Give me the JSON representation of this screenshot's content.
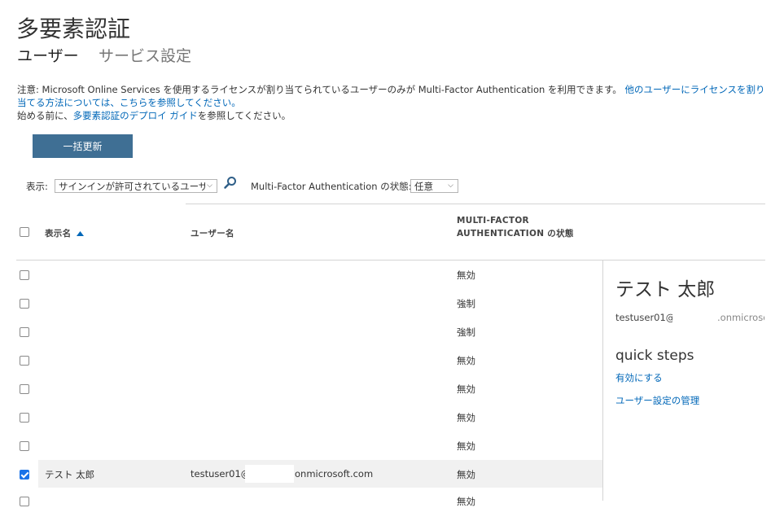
{
  "page": {
    "title": "多要素認証",
    "tabs": [
      {
        "label": "ユーザー",
        "active": true
      },
      {
        "label": "サービス設定",
        "active": false
      }
    ]
  },
  "notice": {
    "line1_prefix": "注意: Microsoft Online Services を使用するライセンスが割り当てられているユーザーのみが Multi-Factor Authentication を利用できます。",
    "line1_link": "他のユーザーにライセンスを割り当てる方法については、こちらを参照してください。",
    "line2_prefix": "始める前に、",
    "line2_link": "多要素認証のデプロイ ガイド",
    "line2_suffix": "を参照してください。"
  },
  "bulk_update_label": "一括更新",
  "filters": {
    "show_label": "表示:",
    "show_value": "サインインが許可されているユーザー",
    "mfa_state_label": "Multi-Factor Authentication の状態:",
    "mfa_state_value": "任意"
  },
  "table": {
    "columns": {
      "display_name": "表示名",
      "user_name": "ユーザー名",
      "mfa_state": "MULTI-FACTOR AUTHENTICATION の状態"
    },
    "rows": [
      {
        "display_name": "",
        "user_name": "",
        "status": "無効",
        "checked": false
      },
      {
        "display_name": "",
        "user_name": "",
        "status": "強制",
        "checked": false
      },
      {
        "display_name": "",
        "user_name": "",
        "status": "強制",
        "checked": false
      },
      {
        "display_name": "",
        "user_name": "",
        "status": "無効",
        "checked": false
      },
      {
        "display_name": "",
        "user_name": "",
        "status": "無効",
        "checked": false
      },
      {
        "display_name": "",
        "user_name": "",
        "status": "無効",
        "checked": false
      },
      {
        "display_name": "",
        "user_name": "",
        "status": "無効",
        "checked": false
      },
      {
        "display_name": "テスト 太郎",
        "user_name_prefix": "testuser01@",
        "user_name_suffix": "onmicrosoft.com",
        "status": "無効",
        "checked": true
      },
      {
        "display_name": "",
        "user_name": "",
        "status": "無効",
        "checked": false
      }
    ]
  },
  "detail_panel": {
    "name": "テスト 太郎",
    "email_prefix": "testuser01@",
    "email_suffix": ".onmicrosoft.com",
    "quick_steps_title": "quick steps",
    "actions": [
      "有効にする",
      "ユーザー設定の管理"
    ]
  },
  "colors": {
    "link": "#0067b8",
    "button_bg": "#3f6f94",
    "checkbox_checked": "#1a73e8"
  },
  "icons": {
    "search": "search-icon",
    "sort": "sort-ascending-icon",
    "dropdown": "chevron-down-icon"
  }
}
